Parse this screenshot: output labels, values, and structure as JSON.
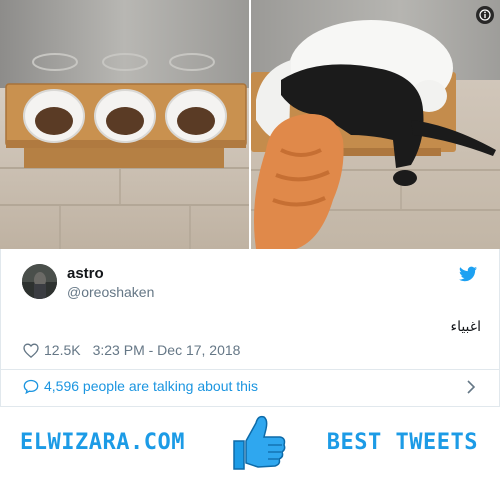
{
  "tweet": {
    "author_name": "astro",
    "author_handle": "@oreoshaken",
    "text": "اغبياء",
    "likes": "12.5K",
    "timestamp": "3:23 PM - Dec 17, 2018",
    "talking": "4,596 people are talking about this"
  },
  "banner": {
    "site": "ELWIZARA.COM",
    "tagline": "BEST TWEETS"
  },
  "icons": {
    "info": "info-icon",
    "bird": "twitter-bird-icon",
    "heart": "heart-icon",
    "bubble": "comment-bubble-icon",
    "chevron": "chevron-right-icon",
    "thumb": "thumbs-up-icon"
  },
  "colors": {
    "twitter_blue": "#1da1f2",
    "link_blue": "#1b95e0",
    "brand_blue": "#1c9be6",
    "muted": "#657786"
  }
}
